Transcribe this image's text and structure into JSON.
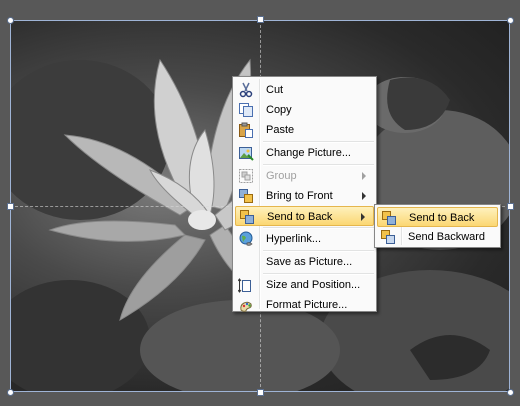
{
  "context_menu": {
    "items": [
      {
        "label": "Cut",
        "icon": "scissors-icon"
      },
      {
        "label": "Copy",
        "icon": "copy-icon"
      },
      {
        "label": "Paste",
        "icon": "clipboard-paste-icon"
      },
      {
        "label": "Change Picture...",
        "icon": "change-picture-icon"
      },
      {
        "label": "Group",
        "icon": "group-icon",
        "disabled": true
      },
      {
        "label": "Bring to Front",
        "icon": "bring-to-front-icon"
      },
      {
        "label": "Send to Back",
        "icon": "send-to-back-icon",
        "highlighted": true
      },
      {
        "label": "Hyperlink...",
        "icon": "globe-link-icon"
      },
      {
        "label": "Save as Picture...",
        "icon": "save-as-picture-icon"
      },
      {
        "label": "Size and Position...",
        "icon": "size-position-icon"
      },
      {
        "label": "Format Picture...",
        "icon": "format-picture-icon"
      }
    ]
  },
  "submenu": {
    "items": [
      {
        "label": "Send to Back",
        "icon": "send-to-back-icon",
        "highlighted": true
      },
      {
        "label": "Send Backward",
        "icon": "send-backward-icon"
      }
    ]
  },
  "colors": {
    "highlight_top": "#fef1bd",
    "highlight_bottom": "#fbd773",
    "highlight_border": "#e5b64d",
    "selection_border": "#9fb4d6"
  }
}
